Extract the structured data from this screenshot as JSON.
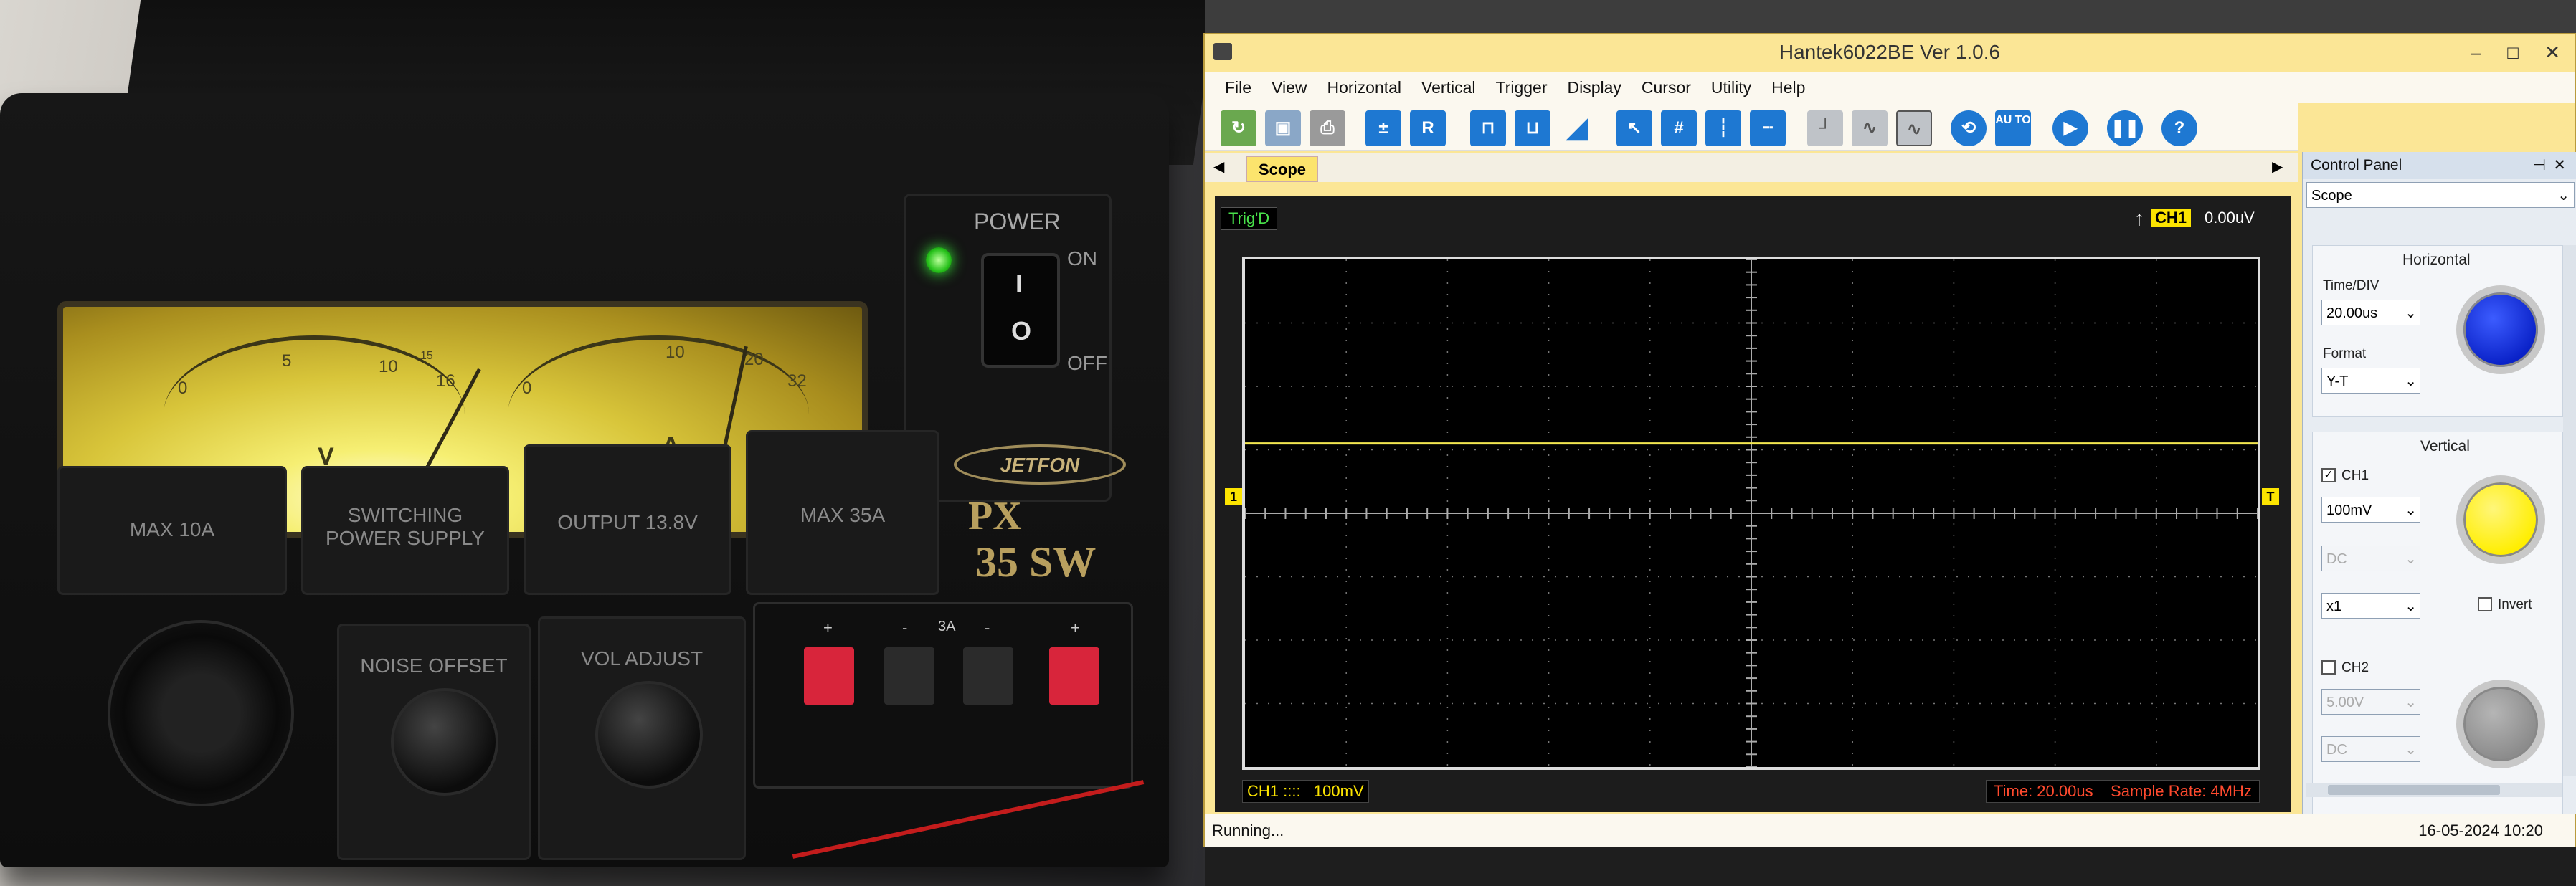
{
  "photo": {
    "meter_left_label": "V",
    "meter_right_label": "A",
    "v_ticks": [
      "0",
      "5",
      "10",
      "15",
      "16"
    ],
    "a_ticks": [
      "0",
      "10",
      "20",
      "32"
    ],
    "power_label": "POWER",
    "on_label": "ON",
    "off_label": "OFF",
    "switch_on_mark": "I",
    "switch_off_mark": "O",
    "brand": "JETFON",
    "model_top": "PX",
    "model": "35 SW",
    "panel_max10a": "MAX 10A",
    "panel_switching": "SWITCHING\nPOWER SUPPLY",
    "panel_output": "OUTPUT 13.8V",
    "panel_max35a": "MAX 35A",
    "noise_offset": "NOISE OFFSET",
    "vol_adjust": "VOL ADJUST",
    "terminal_marks": [
      "+",
      "-",
      "3A",
      "-",
      "+"
    ]
  },
  "window": {
    "title": "Hantek6022BE Ver 1.0.6",
    "controls": [
      "–",
      "□",
      "✕"
    ],
    "menu": [
      "File",
      "View",
      "Horizontal",
      "Vertical",
      "Trigger",
      "Display",
      "Cursor",
      "Utility",
      "Help"
    ],
    "toolbar_labels": {
      "r": "R",
      "auto": "AU TO",
      "help": "?"
    },
    "tab": "Scope",
    "trig_status": "Trig'D",
    "trig_channel": "CH1",
    "trig_level": "0.00uV",
    "ch1_marker": "1",
    "trig_marker": "T",
    "ch1_info": "CH1 ::::",
    "ch1_volt": "100mV",
    "time_info": "Time: 20.00us",
    "sample_rate": "Sample Rate: 4MHz",
    "status": "Running...",
    "datetime": "16-05-2024  10:20"
  },
  "control_panel": {
    "title": "Control Panel",
    "mode": "Scope",
    "horizontal_title": "Horizontal",
    "time_div_label": "Time/DIV",
    "time_div": "20.00us",
    "format_label": "Format",
    "format": "Y-T",
    "vertical_title": "Vertical",
    "ch1_label": "CH1",
    "ch1_volt": "100mV",
    "ch1_coupling": "DC",
    "ch1_probe": "x1",
    "invert_label": "Invert",
    "ch2_label": "CH2",
    "ch2_volt": "5.00V",
    "ch2_coupling": "DC"
  },
  "colors": {
    "window_accent": "#fbe696",
    "ch1_trace": "#f3e650",
    "horizontal_dial": "#0a22c8",
    "ch1_dial": "#ffee00",
    "ch2_dial": "#8c8c8c",
    "toolbar_blue": "#1e78d2"
  }
}
